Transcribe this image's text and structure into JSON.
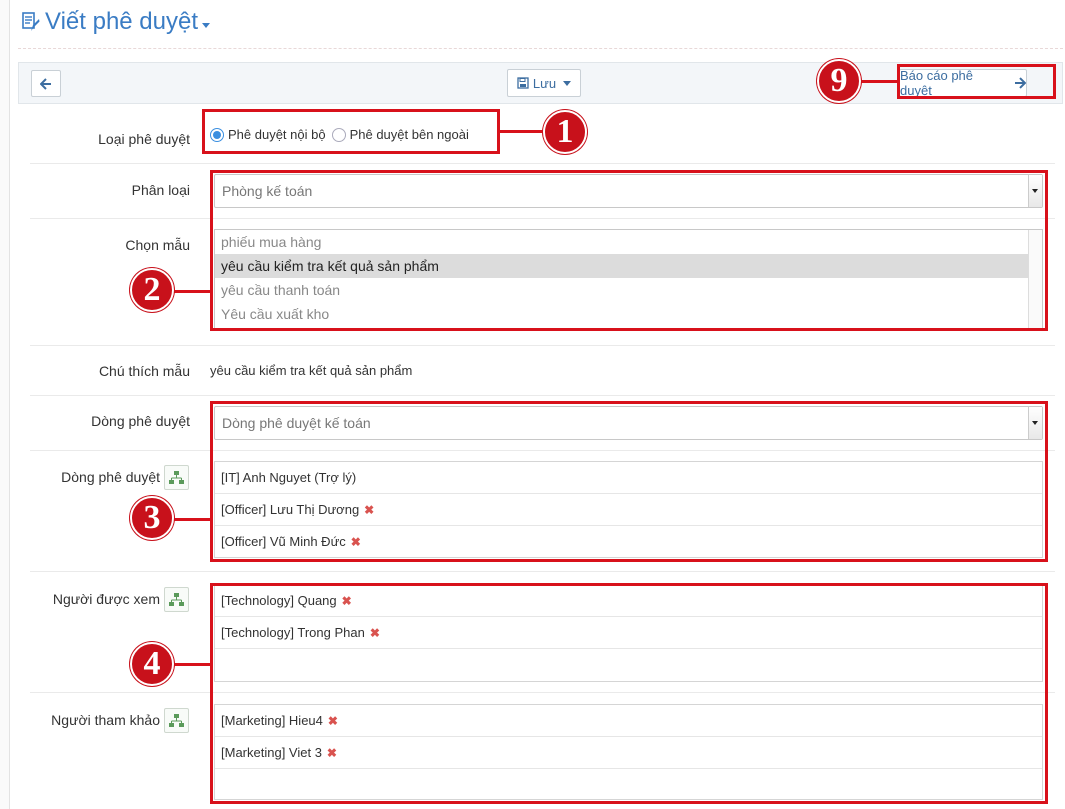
{
  "header": {
    "title": "Viết phê duyệt"
  },
  "toolbar": {
    "save_label": "Lưu",
    "report_label": "Báo cáo phê duyệt"
  },
  "form": {
    "approval_type": {
      "label": "Loại phê duyệt",
      "options": [
        {
          "label": "Phê duyệt nội bộ",
          "checked": true
        },
        {
          "label": "Phê duyệt bên ngoài",
          "checked": false
        }
      ]
    },
    "category": {
      "label": "Phân loại",
      "value": "Phòng kế toán"
    },
    "template": {
      "label": "Chọn mẫu",
      "options": [
        "phiếu mua hàng",
        "yêu cầu kiểm tra kết quả sản phẩm",
        "yêu cầu thanh toán",
        "Yêu cầu xuất kho"
      ],
      "selected": "yêu cầu kiểm tra kết quả sản phẩm"
    },
    "template_note": {
      "label": "Chú thích mẫu",
      "value": "yêu cầu kiểm tra kết quả sản phẩm"
    },
    "approval_line_select": {
      "label": "Dòng phê duyệt",
      "value": "Dòng phê duyệt kế toán"
    },
    "approval_line": {
      "label": "Dòng phê duyệt",
      "items": [
        "[IT] Anh Nguyet (Trợ lý)",
        "[Officer] Lưu Thị Dương",
        "[Officer] Vũ Minh Đức"
      ]
    },
    "viewers": {
      "label": "Người được xem",
      "items": [
        "[Technology] Quang",
        "[Technology] Trong Phan"
      ]
    },
    "references": {
      "label": "Người tham khảo",
      "items": [
        "[Marketing] Hieu4",
        "[Marketing] Viet 3"
      ]
    }
  },
  "annotations": {
    "m1": "1",
    "m2": "2",
    "m3": "3",
    "m4": "4",
    "m9": "9"
  },
  "colors": {
    "accent": "#3a7cc4",
    "annotation_red": "#d8111b",
    "remove_red": "#d9534f"
  }
}
